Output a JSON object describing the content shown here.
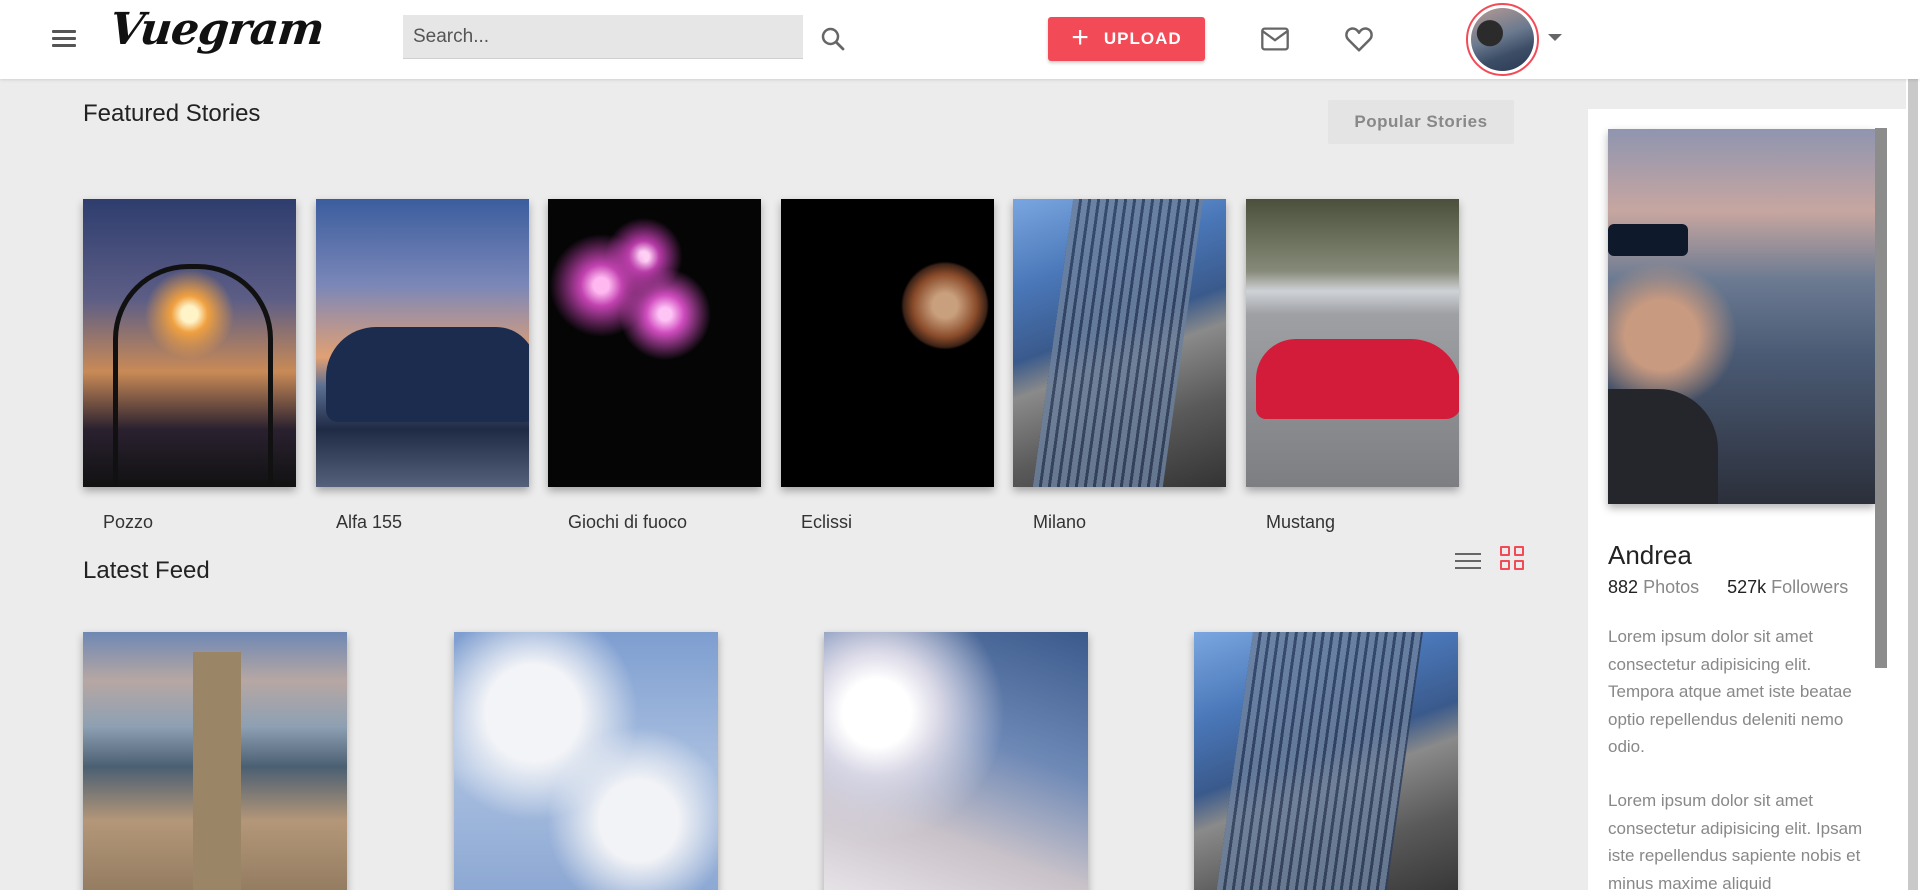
{
  "header": {
    "logo": "Vuegram",
    "search_placeholder": "Search...",
    "upload_label": "UPLOAD",
    "upload_icon": "+"
  },
  "featured": {
    "title": "Featured Stories",
    "popular_label": "Popular Stories",
    "stories": [
      {
        "caption": "Pozzo"
      },
      {
        "caption": "Alfa 155"
      },
      {
        "caption": "Giochi di fuoco"
      },
      {
        "caption": "Eclissi"
      },
      {
        "caption": "Milano"
      },
      {
        "caption": "Mustang"
      }
    ]
  },
  "feed": {
    "title": "Latest Feed"
  },
  "profile": {
    "name": "Andrea",
    "photos_count": "882",
    "photos_label": "Photos",
    "followers_count": "527k",
    "followers_label": "Followers",
    "bio_1": "Lorem ipsum dolor sit amet consectetur adipisicing elit. Tempora atque amet iste beatae optio repellendus deleniti nemo odio.",
    "bio_2": "Lorem ipsum dolor sit amet consectetur adipisicing elit. Ipsam iste repellendus sapiente nobis et minus maxime aliquid"
  },
  "colors": {
    "accent": "#f24b57",
    "background": "#ececec"
  },
  "icons": [
    "menu-icon",
    "search-icon",
    "plus-icon",
    "mail-icon",
    "heart-icon",
    "caret-down-icon",
    "list-view-icon",
    "grid-view-icon"
  ]
}
